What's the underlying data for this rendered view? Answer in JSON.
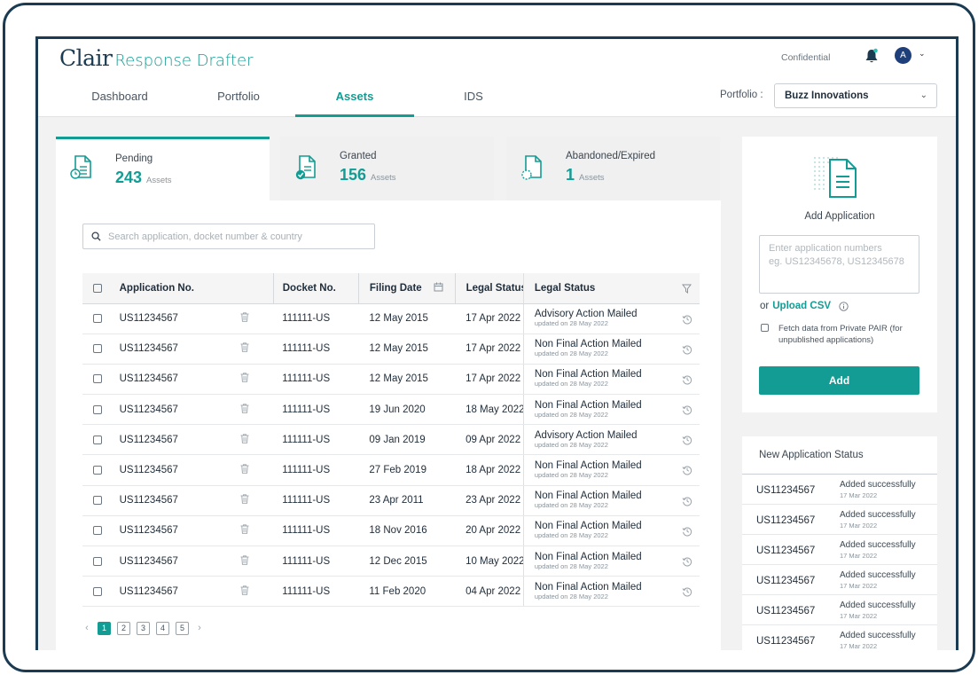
{
  "brand": {
    "name_a": "Clair",
    "name_b": "Response Drafter"
  },
  "header": {
    "confidential": "Confidential",
    "avatar_initial": "A"
  },
  "nav": {
    "tabs": [
      {
        "label": "Dashboard"
      },
      {
        "label": "Portfolio"
      },
      {
        "label": "Assets"
      },
      {
        "label": "IDS"
      }
    ]
  },
  "portfolio": {
    "label": "Portfolio :",
    "selected": "Buzz Innovations"
  },
  "status_cards": [
    {
      "label": "Pending",
      "count": "243",
      "unit": "Assets"
    },
    {
      "label": "Granted",
      "count": "156",
      "unit": "Assets"
    },
    {
      "label": "Abandoned/Expired",
      "count": "1",
      "unit": "Assets"
    }
  ],
  "search": {
    "placeholder": "Search application, docket number & country"
  },
  "table": {
    "headers": {
      "application": "Application No.",
      "docket": "Docket No.",
      "filing": "Filing Date",
      "legal1": "Legal Status",
      "legal2": "Legal Status"
    },
    "rows": [
      {
        "app": "US11234567",
        "docket": "111111-US",
        "filing": "12 May 2015",
        "legal_date": "17 Apr 2022",
        "status": "Advisory Action Mailed",
        "updated": "updated on 28 May 2022"
      },
      {
        "app": "US11234567",
        "docket": "111111-US",
        "filing": "12 May 2015",
        "legal_date": "17 Apr 2022",
        "status": "Non Final Action Mailed",
        "updated": "updated on 28 May 2022"
      },
      {
        "app": "US11234567",
        "docket": "111111-US",
        "filing": "12 May 2015",
        "legal_date": "17 Apr 2022",
        "status": "Non Final Action Mailed",
        "updated": "updated on 28 May 2022"
      },
      {
        "app": "US11234567",
        "docket": "111111-US",
        "filing": "19 Jun 2020",
        "legal_date": "18 May 2022",
        "status": "Non Final Action Mailed",
        "updated": "updated on 28 May 2022"
      },
      {
        "app": "US11234567",
        "docket": "111111-US",
        "filing": "09 Jan 2019",
        "legal_date": "09 Apr 2022",
        "status": "Advisory Action Mailed",
        "updated": "updated on 28 May 2022"
      },
      {
        "app": "US11234567",
        "docket": "111111-US",
        "filing": "27 Feb 2019",
        "legal_date": "18 Apr 2022",
        "status": "Non Final Action Mailed",
        "updated": "updated on 28 May 2022"
      },
      {
        "app": "US11234567",
        "docket": "111111-US",
        "filing": "23 Apr 2011",
        "legal_date": "23 Apr 2022",
        "status": "Non Final Action Mailed",
        "updated": "updated on 28 May 2022"
      },
      {
        "app": "US11234567",
        "docket": "111111-US",
        "filing": "18 Nov 2016",
        "legal_date": "20 Apr 2022",
        "status": "Non Final Action Mailed",
        "updated": "updated on 28 May 2022"
      },
      {
        "app": "US11234567",
        "docket": "111111-US",
        "filing": "12 Dec 2015",
        "legal_date": "10 May 2022",
        "status": "Non Final Action Mailed",
        "updated": "updated on 28 May 2022"
      },
      {
        "app": "US11234567",
        "docket": "111111-US",
        "filing": "11 Feb 2020",
        "legal_date": "04 Apr 2022",
        "status": "Non Final Action Mailed",
        "updated": "updated on 28 May 2022"
      }
    ]
  },
  "pagination": {
    "pages": [
      "1",
      "2",
      "3",
      "4",
      "5"
    ],
    "current": "1"
  },
  "add_application": {
    "title": "Add Application",
    "placeholder": "Enter application numbers\neg. US12345678, US12345678",
    "or_text": "or",
    "upload_label": "Upload CSV",
    "pair_label": "Fetch data from Private PAIR (for unpublished applications)",
    "button": "Add"
  },
  "new_status": {
    "title": "New Application Status",
    "rows": [
      {
        "app": "US11234567",
        "status": "Added successfully",
        "date": "17 Mar 2022"
      },
      {
        "app": "US11234567",
        "status": "Added successfully",
        "date": "17 Mar 2022"
      },
      {
        "app": "US11234567",
        "status": "Added successfully",
        "date": "17 Mar 2022"
      },
      {
        "app": "US11234567",
        "status": "Added successfully",
        "date": "17 Mar 2022"
      },
      {
        "app": "US11234567",
        "status": "Added successfully",
        "date": "17 Mar 2022"
      },
      {
        "app": "US11234567",
        "status": "Added successfully",
        "date": "17 Mar 2022"
      }
    ]
  },
  "colors": {
    "accent": "#139c93",
    "frame": "#1b3b52",
    "avatar": "#1e3f7a"
  },
  "icons": {
    "bell": "bell-icon",
    "search": "search-icon",
    "trash": "trash-icon",
    "history": "history-icon",
    "filter": "filter-icon",
    "calendar": "calendar-icon",
    "info": "info-icon"
  }
}
